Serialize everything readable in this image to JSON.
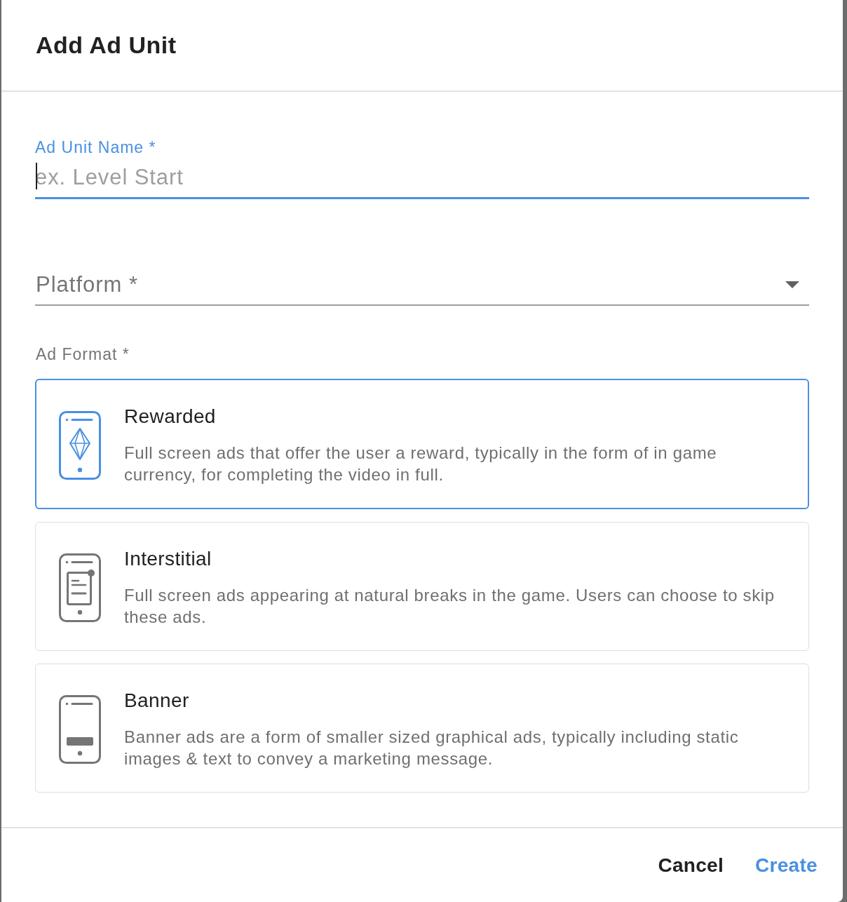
{
  "dialog": {
    "title": "Add Ad Unit"
  },
  "fields": [
    {
      "kind": "text",
      "label": "Ad Unit Name *",
      "placeholder": "ex. Level Start",
      "focused": true
    },
    {
      "kind": "select",
      "label": "Platform *",
      "focused": false
    }
  ],
  "ad_format": {
    "label": "Ad Format *",
    "options": [
      {
        "kind": "rewarded",
        "title": "Rewarded",
        "description": "Full screen ads that offer the user a reward, typically in the form of in game currency, for completing the video in full.",
        "selected": true
      },
      {
        "kind": "interstitial",
        "title": "Interstitial",
        "description": "Full screen ads appearing at natural breaks in the game. Users can choose to skip these ads.",
        "selected": false
      },
      {
        "kind": "banner",
        "title": "Banner",
        "description": "Banner ads are a form of smaller sized graphical ads, typically including static images & text to convey a marketing message.",
        "selected": false
      }
    ]
  },
  "buttons": [
    {
      "kind": "secondary",
      "label": "Cancel"
    },
    {
      "kind": "primary",
      "label": "Create"
    }
  ]
}
